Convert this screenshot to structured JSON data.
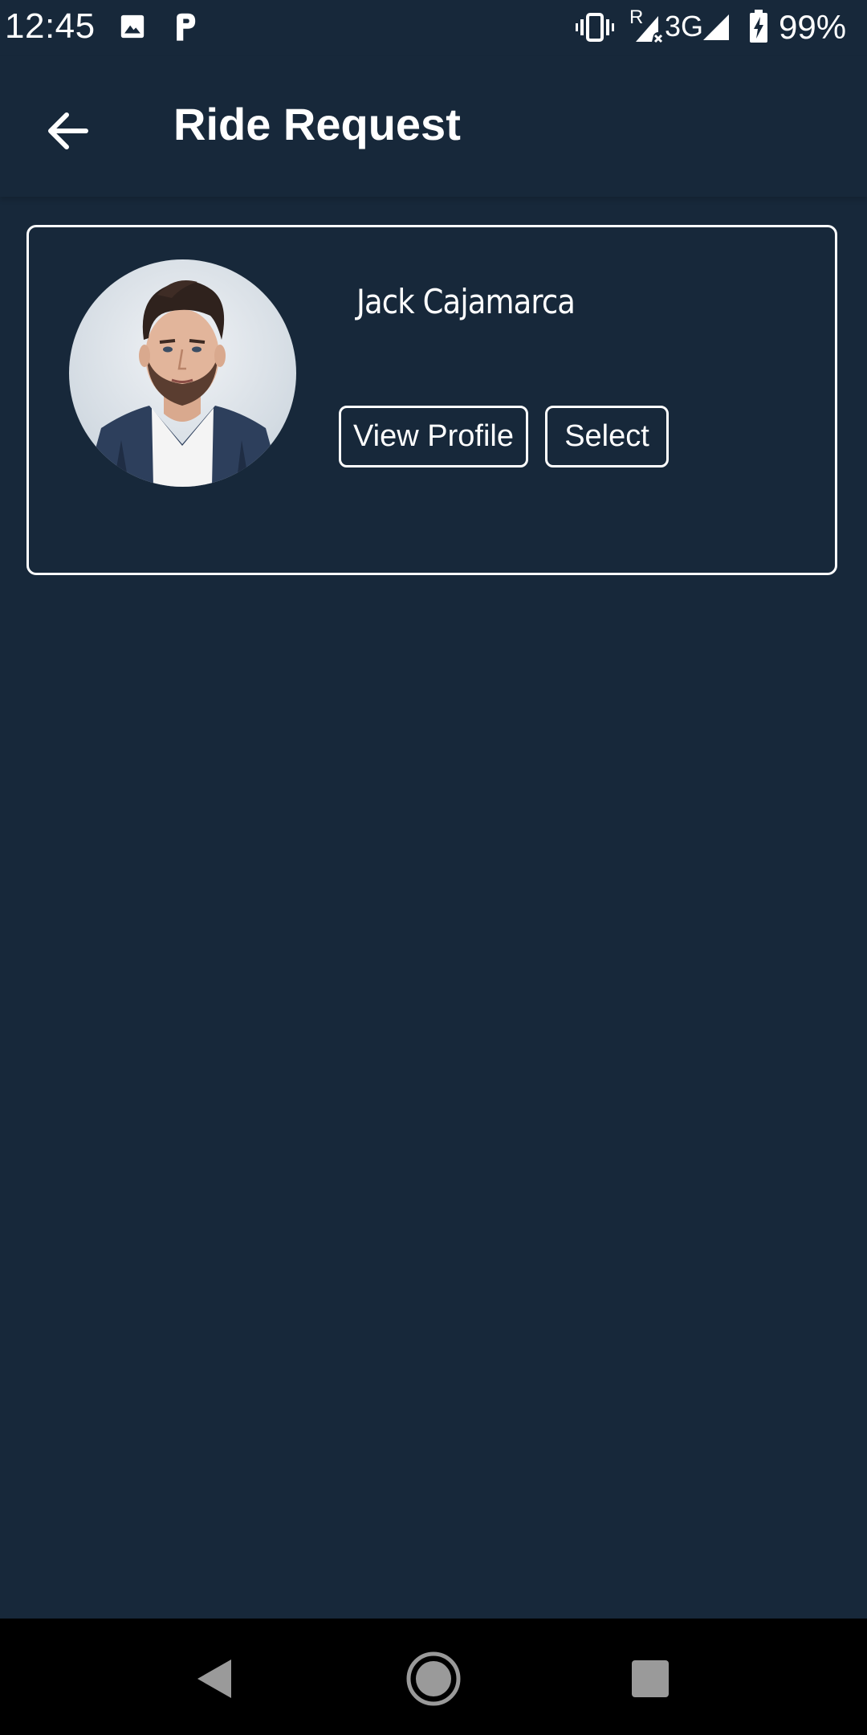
{
  "status_bar": {
    "time": "12:45",
    "network": "3G",
    "roaming": "R",
    "battery": "99%",
    "icons": [
      "image-icon",
      "parking-app-icon",
      "vibrate-icon",
      "signal-icon",
      "battery-icon"
    ]
  },
  "app_bar": {
    "title": "Ride Request",
    "back_icon": "arrow-left-icon"
  },
  "request": {
    "driver_name": "Jack Cajamarca",
    "view_profile_label": "View Profile",
    "select_label": "Select"
  },
  "nav_bar": {
    "icons": [
      "back-triangle-icon",
      "home-circle-icon",
      "recents-square-icon"
    ]
  },
  "colors": {
    "background": "#17283a",
    "text": "#ffffff",
    "nav_background": "#000000",
    "nav_icons": "#9a9a9a"
  }
}
